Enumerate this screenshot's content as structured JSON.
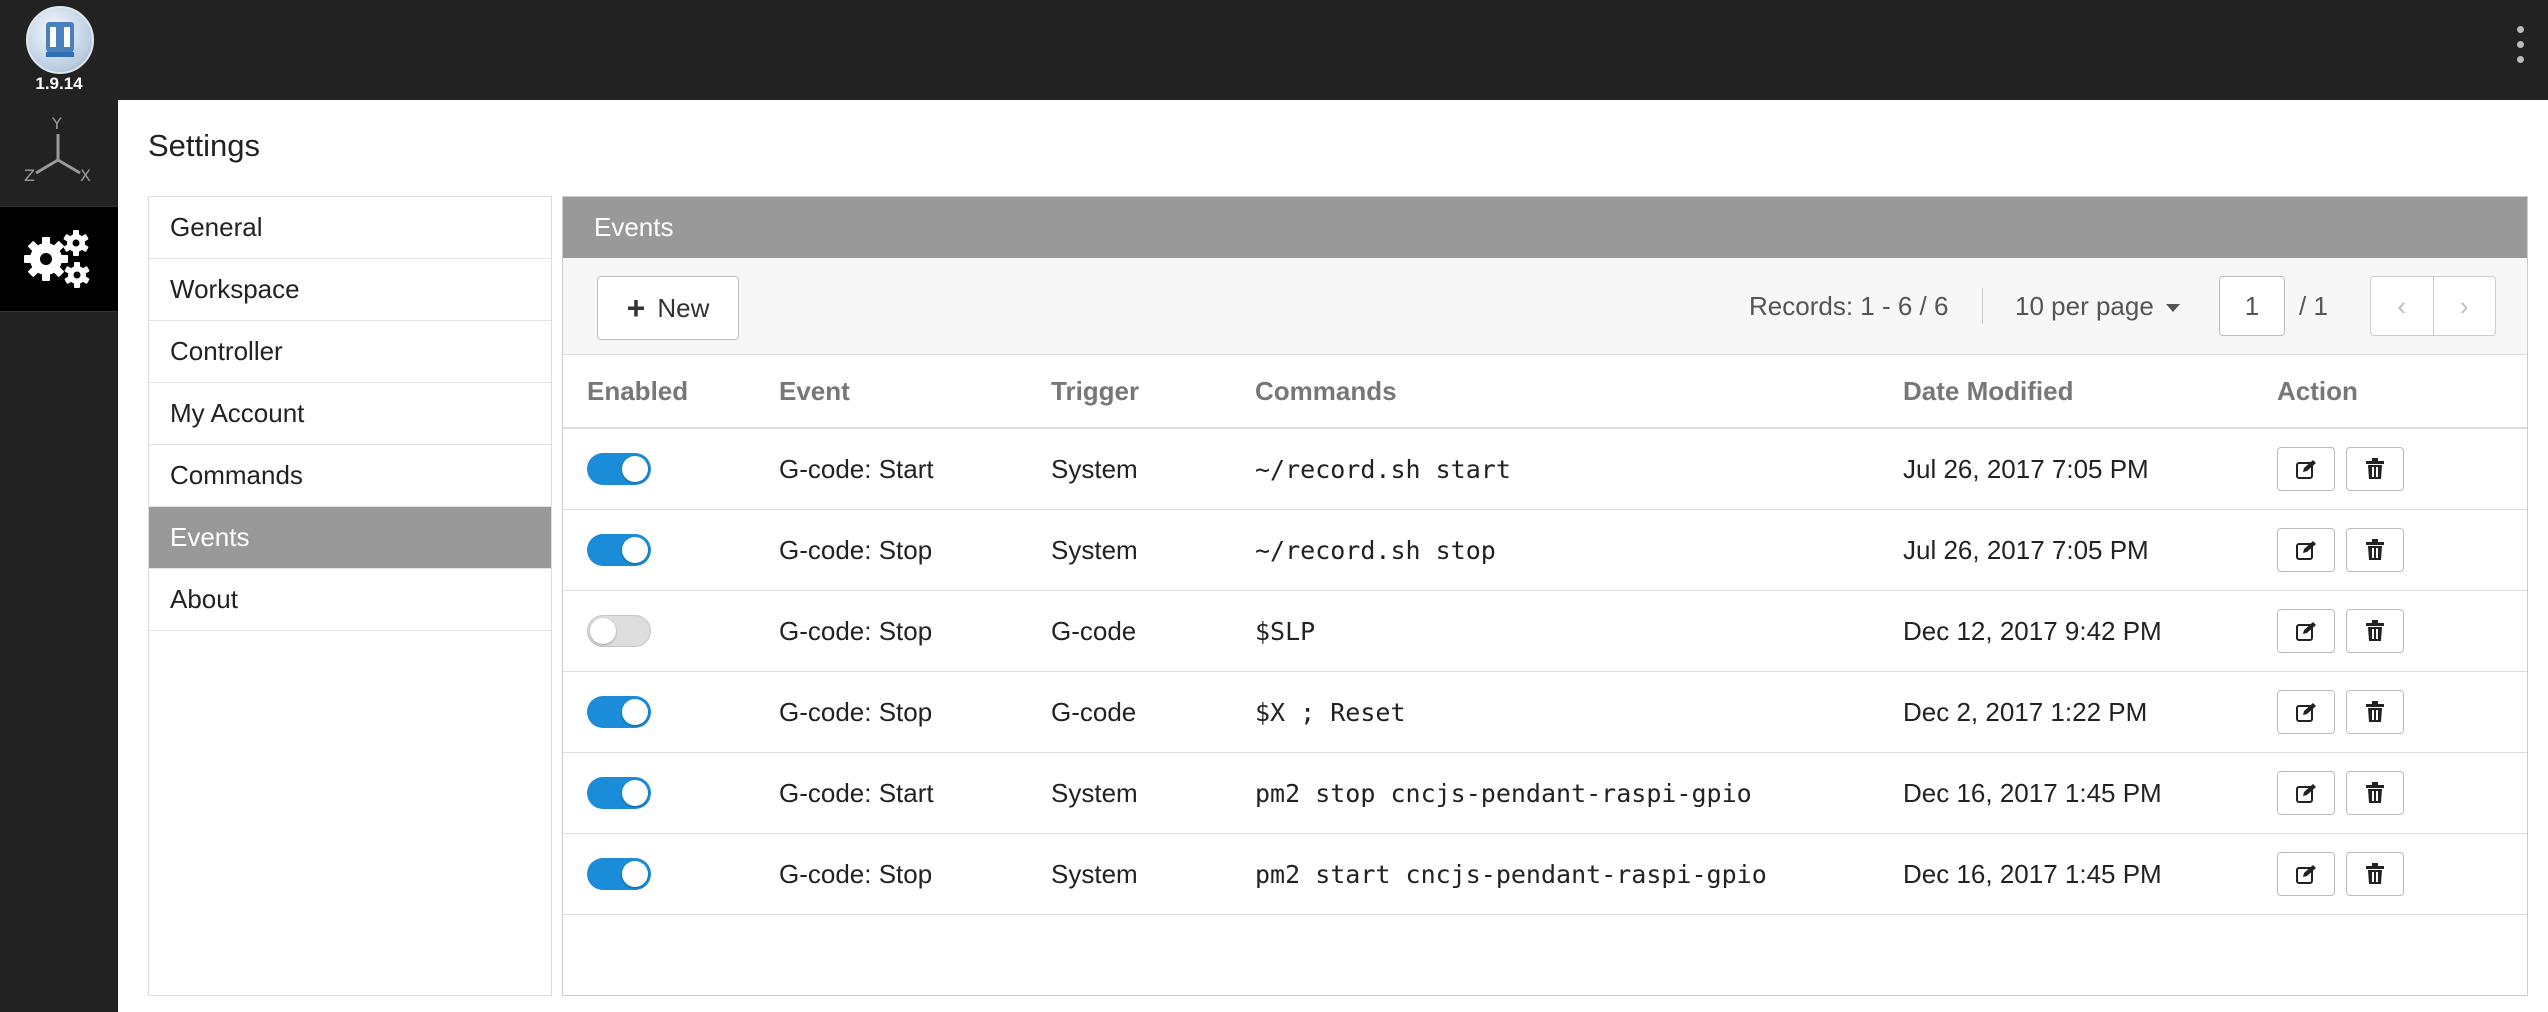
{
  "app": {
    "version": "1.9.14"
  },
  "page": {
    "title": "Settings"
  },
  "nav": {
    "items": [
      {
        "label": "General"
      },
      {
        "label": "Workspace"
      },
      {
        "label": "Controller"
      },
      {
        "label": "My Account"
      },
      {
        "label": "Commands"
      },
      {
        "label": "Events",
        "active": true
      },
      {
        "label": "About"
      }
    ]
  },
  "panel": {
    "title": "Events",
    "new_label": "New",
    "records_label": "Records: 1 - 6 / 6",
    "per_page_label": "10 per page",
    "page_value": "1",
    "page_total": "/  1"
  },
  "table": {
    "headers": {
      "enabled": "Enabled",
      "event": "Event",
      "trigger": "Trigger",
      "commands": "Commands",
      "date_modified": "Date Modified",
      "action": "Action"
    },
    "rows": [
      {
        "enabled": true,
        "event": "G-code: Start",
        "trigger": "System",
        "commands": "~/record.sh start",
        "date": "Jul 26, 2017 7:05 PM"
      },
      {
        "enabled": true,
        "event": "G-code: Stop",
        "trigger": "System",
        "commands": "~/record.sh stop",
        "date": "Jul 26, 2017 7:05 PM"
      },
      {
        "enabled": false,
        "event": "G-code: Stop",
        "trigger": "G-code",
        "commands": "$SLP",
        "date": "Dec 12, 2017 9:42 PM"
      },
      {
        "enabled": true,
        "event": "G-code: Stop",
        "trigger": "G-code",
        "commands": "$X ; Reset",
        "date": "Dec 2, 2017 1:22 PM"
      },
      {
        "enabled": true,
        "event": "G-code: Start",
        "trigger": "System",
        "commands": "pm2 stop cncjs-pendant-raspi-gpio",
        "date": "Dec 16, 2017 1:45 PM"
      },
      {
        "enabled": true,
        "event": "G-code: Stop",
        "trigger": "System",
        "commands": "pm2 start cncjs-pendant-raspi-gpio",
        "date": "Dec 16, 2017 1:45 PM"
      }
    ]
  },
  "icons": {
    "logo": "cncjs-logo-icon",
    "workspace": "axes-icon",
    "settings": "gears-icon",
    "menu": "kebab-menu-icon",
    "add": "plus-icon",
    "edit": "edit-icon",
    "delete": "trash-icon",
    "prev": "chevron-left-icon",
    "next": "chevron-right-icon"
  },
  "colors": {
    "chrome": "#222222",
    "active_gray": "#999999",
    "toggle_on": "#1a8cd8"
  }
}
